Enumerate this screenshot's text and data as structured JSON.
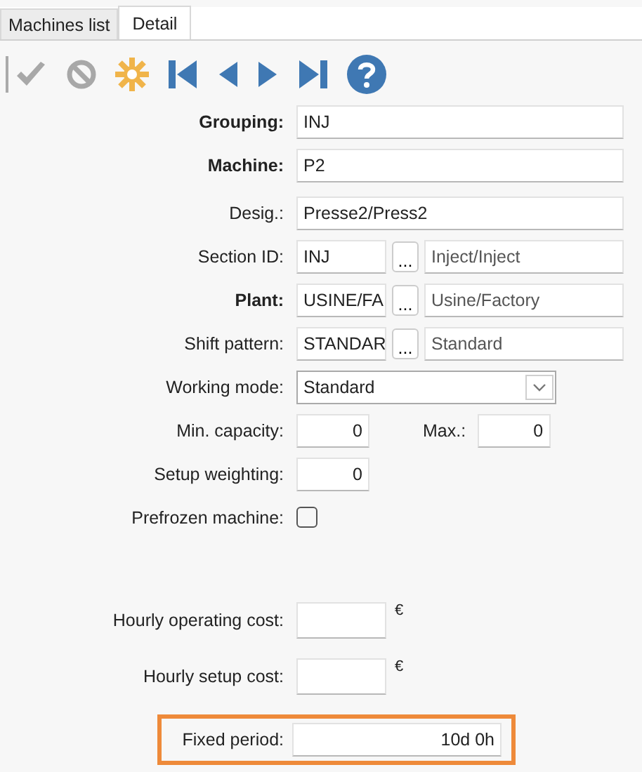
{
  "tabs": [
    {
      "label": "Machines list",
      "selected": false
    },
    {
      "label": "Detail",
      "selected": true
    }
  ],
  "fields": [
    {
      "kind": "text",
      "label": "Grouping:",
      "bold": true,
      "value": "INJ"
    },
    {
      "kind": "text",
      "label": "Machine:",
      "bold": true,
      "value": "P2"
    },
    {
      "kind": "text",
      "label": "Desig.:",
      "bold": false,
      "value": "Presse2/Press2"
    },
    {
      "kind": "lookup",
      "label": "Section ID:",
      "bold": false,
      "value": "INJ",
      "button": "...",
      "description": "Inject/Inject"
    },
    {
      "kind": "lookup",
      "label": "Plant:",
      "bold": true,
      "value": "USINE/FA",
      "button": "...",
      "description": "Usine/Factory"
    },
    {
      "kind": "lookup",
      "label": "Shift pattern:",
      "bold": false,
      "value": "STANDAR",
      "button": "...",
      "description": "Standard"
    },
    {
      "kind": "select",
      "label": "Working mode:",
      "bold": false,
      "value": "Standard"
    },
    {
      "kind": "range",
      "label": "Min. capacity:",
      "bold": false,
      "value": "0",
      "label_2": "Max.:",
      "value_2": "0"
    },
    {
      "kind": "number",
      "label": "Setup weighting:",
      "bold": false,
      "value": "0"
    },
    {
      "kind": "checkbox",
      "label": "Prefrozen machine:",
      "bold": false,
      "checked": false
    }
  ],
  "cost_fields": [
    {
      "kind": "currency",
      "label": "Hourly operating cost:",
      "unit": "€",
      "highlighted": false
    },
    {
      "kind": "currency",
      "label": "Hourly setup cost:",
      "unit": "€",
      "highlighted": false
    },
    {
      "kind": "duration",
      "label": "Fixed period:",
      "value": "10d 0h",
      "highlighted": true
    }
  ]
}
